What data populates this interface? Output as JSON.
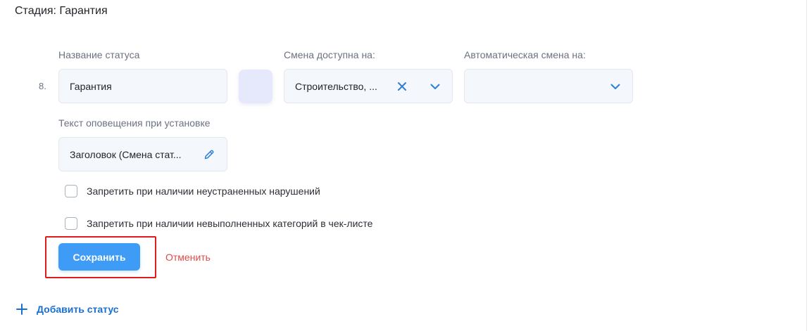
{
  "stage": {
    "title": "Стадия: Гарантия"
  },
  "status_row": {
    "number": "8.",
    "name_label": "Название статуса",
    "name_value": "Гарантия",
    "change_label": "Смена доступна на:",
    "change_value": "Строительство, ...",
    "auto_label": "Автоматическая смена на:",
    "auto_value": ""
  },
  "notification": {
    "label": "Текст оповещения при установке",
    "value": "Заголовок (Смена стат..."
  },
  "checkboxes": [
    {
      "label": "Запретить при наличии неустраненных нарушений",
      "checked": false
    },
    {
      "label": "Запретить при наличии невыполненных категорий в чек-листе",
      "checked": false
    }
  ],
  "actions": {
    "save_label": "Сохранить",
    "cancel_label": "Отменить"
  },
  "footer": {
    "add_status_label": "Добавить статус"
  },
  "colors": {
    "accent": "#3f9cf6",
    "link": "#1a6fd1",
    "danger": "#e04a4a",
    "highlight": "#e01b1b",
    "swatch": "#e6e9fb"
  },
  "icons": {
    "clear": "close-icon",
    "dropdown": "chevron-down-icon",
    "edit": "pencil-icon",
    "add": "plus-icon"
  }
}
